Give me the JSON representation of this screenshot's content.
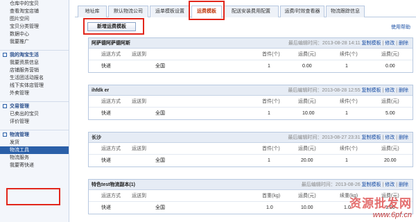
{
  "sidebar": {
    "top_items": [
      "仓库中的宝贝",
      "查看淘宝店铺",
      "图片空间",
      "宝贝分类管理",
      "数据中心",
      "我要推广"
    ],
    "sections": [
      {
        "title": "我的淘宝生活",
        "items": [
          "我要资质信息",
          "店铺服务营销",
          "生活团活动报名",
          "线下实体店管理",
          "外卖管理"
        ]
      },
      {
        "title": "交易管理",
        "items": [
          "已卖出的宝贝",
          "评价管理"
        ]
      },
      {
        "title": "物流管理",
        "items": [
          "发货",
          "物流工具",
          "物流服务",
          "我要寄快递"
        ]
      }
    ]
  },
  "tabs": [
    "地址库",
    "默认物流公司",
    "运单模板设置",
    "运费模板",
    "配送安装费用配置",
    "运费/时效查看器",
    "物流跟踪信息"
  ],
  "active_tab": "运费模板",
  "actions": {
    "add_template": "新增运费模板",
    "help": "使用帮助"
  },
  "columns": {
    "method": "运送方式",
    "dest": "运送到",
    "first": "首件(个)",
    "fee": "运费(元)",
    "cont": "续件(个)",
    "rest": "运费(元)"
  },
  "columns_weight": {
    "method": "运送方式",
    "dest": "运送到",
    "first": "首重(kg)",
    "fee": "运费(元)",
    "cont": "续重(kg)",
    "rest": "运费(元)"
  },
  "templates": [
    {
      "name": "阿萨德阿萨德阿斯",
      "updated": "最后编辑时间：2013-08-28 14:11",
      "copy": "复制模板",
      "edit": "修改",
      "delete": "删除",
      "row": {
        "method": "快递",
        "dest": "全国",
        "first": "1",
        "fee": "0.00",
        "cont": "1",
        "rest": "0.00"
      }
    },
    {
      "name": "ihfdk er",
      "updated": "最后编辑时间：2013-08-28 12:55",
      "copy": "复制模板",
      "edit": "修改",
      "delete": "删除",
      "row": {
        "method": "快递",
        "dest": "全国",
        "first": "1",
        "fee": "10.00",
        "cont": "1",
        "rest": "5.00"
      }
    },
    {
      "name": "长沙",
      "updated": "最后编辑时间：2013-08-27 23:31",
      "copy": "复制模板",
      "edit": "修改",
      "delete": "删除",
      "row": {
        "method": "快递",
        "dest": "全国",
        "first": "1",
        "fee": "20.00",
        "cont": "1",
        "rest": "20.00"
      }
    },
    {
      "name": "特色test物流副本(1)",
      "updated": "最后编辑时间：2013-08-26",
      "copy": "复制模板",
      "edit": "修改",
      "delete": "删除",
      "row": {
        "method": "快递",
        "dest": "全国",
        "first": "1.0",
        "fee": "10.00",
        "cont": "1.0",
        "rest": "1.00"
      }
    }
  ],
  "watermark": {
    "cn": "资源批发网",
    "url": "www.6pf.cn"
  },
  "colors": {
    "accent": "#2a5fa8",
    "highlight_box": "#e2261b",
    "link": "#1a4fa5"
  }
}
